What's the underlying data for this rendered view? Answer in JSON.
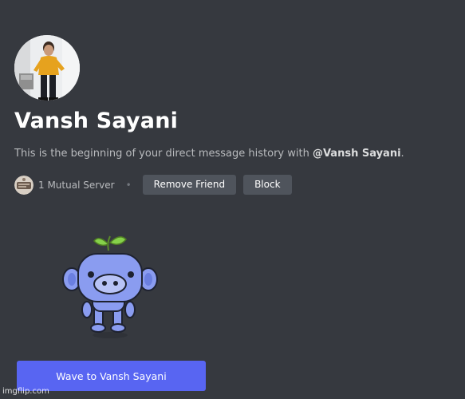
{
  "profile": {
    "display_name": "Vansh Sayani",
    "intro_prefix": "This is the beginning of your direct message history with ",
    "intro_mention": "@Vansh Sayani",
    "intro_suffix": "."
  },
  "mutual": {
    "label": "1 Mutual Server",
    "separator": "•"
  },
  "actions": {
    "remove_friend_label": "Remove Friend",
    "block_label": "Block"
  },
  "wave": {
    "label": "Wave to Vansh Sayani"
  },
  "watermark": {
    "text": "imgflip.com"
  },
  "icons": {
    "avatar": "user-avatar-photo",
    "server": "server-icon",
    "mascot": "wumpus-sprout-illustration"
  },
  "colors": {
    "background": "#36393f",
    "button_secondary": "#4f545c",
    "button_primary": "#5865f2",
    "text_muted": "#b9bbbe",
    "text_white": "#ffffff",
    "wumpus_blue": "#8a9cf0",
    "leaf_green": "#86d14a"
  }
}
